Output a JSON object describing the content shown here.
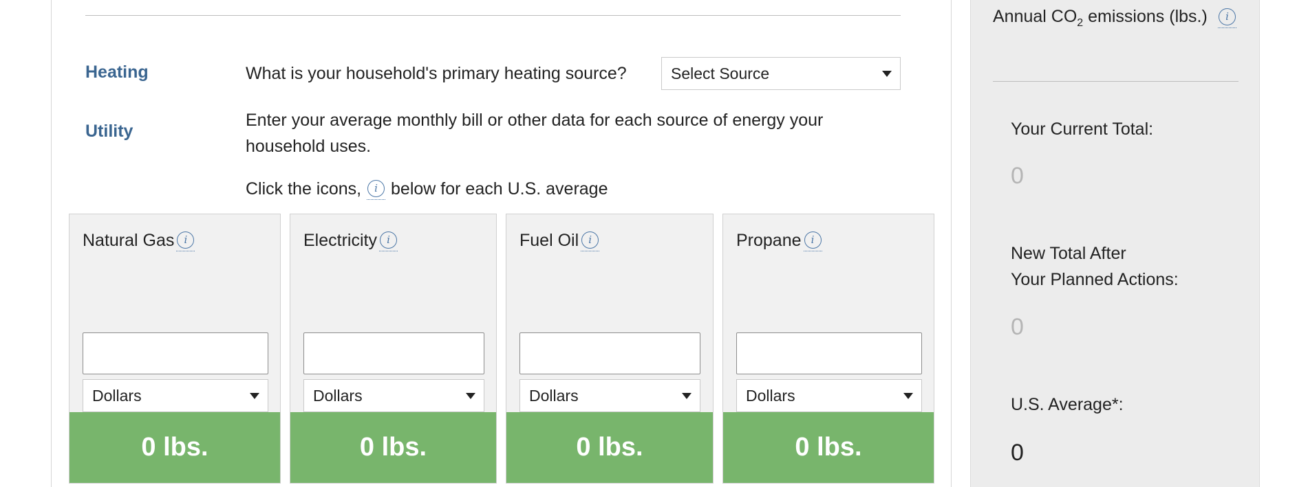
{
  "heating": {
    "label": "Heating",
    "question": "What is your household's primary heating source?",
    "select_value": "Select Source"
  },
  "utility": {
    "label": "Utility",
    "instructions": "Enter your average monthly bill or other data for each source of energy your household uses.",
    "hint_before": "Click the icons,",
    "hint_after": "below for each U.S. average"
  },
  "info_icon_glyph": "i",
  "cards": [
    {
      "title": "Natural Gas",
      "input_value": "",
      "unit": "Dollars",
      "total": "0 lbs."
    },
    {
      "title": "Electricity",
      "input_value": "",
      "unit": "Dollars",
      "total": "0 lbs."
    },
    {
      "title": "Fuel Oil",
      "input_value": "",
      "unit": "Dollars",
      "total": "0 lbs."
    },
    {
      "title": "Propane",
      "input_value": "",
      "unit": "Dollars",
      "total": "0 lbs."
    }
  ],
  "sidebar": {
    "title_prefix": "Annual CO",
    "title_subscript": "2",
    "title_suffix": " emissions (lbs.)",
    "current_total_label": "Your Current Total:",
    "current_total_value": "0",
    "new_total_label_line1": "New Total After",
    "new_total_label_line2": "Your Planned Actions:",
    "new_total_value": "0",
    "us_average_label": "U.S. Average*:",
    "us_average_value": "0"
  },
  "colors": {
    "accent_label": "#3a6590",
    "info_icon": "#4b76a6",
    "card_total_bg": "#78b56c",
    "sidebar_bg": "#ececec"
  }
}
